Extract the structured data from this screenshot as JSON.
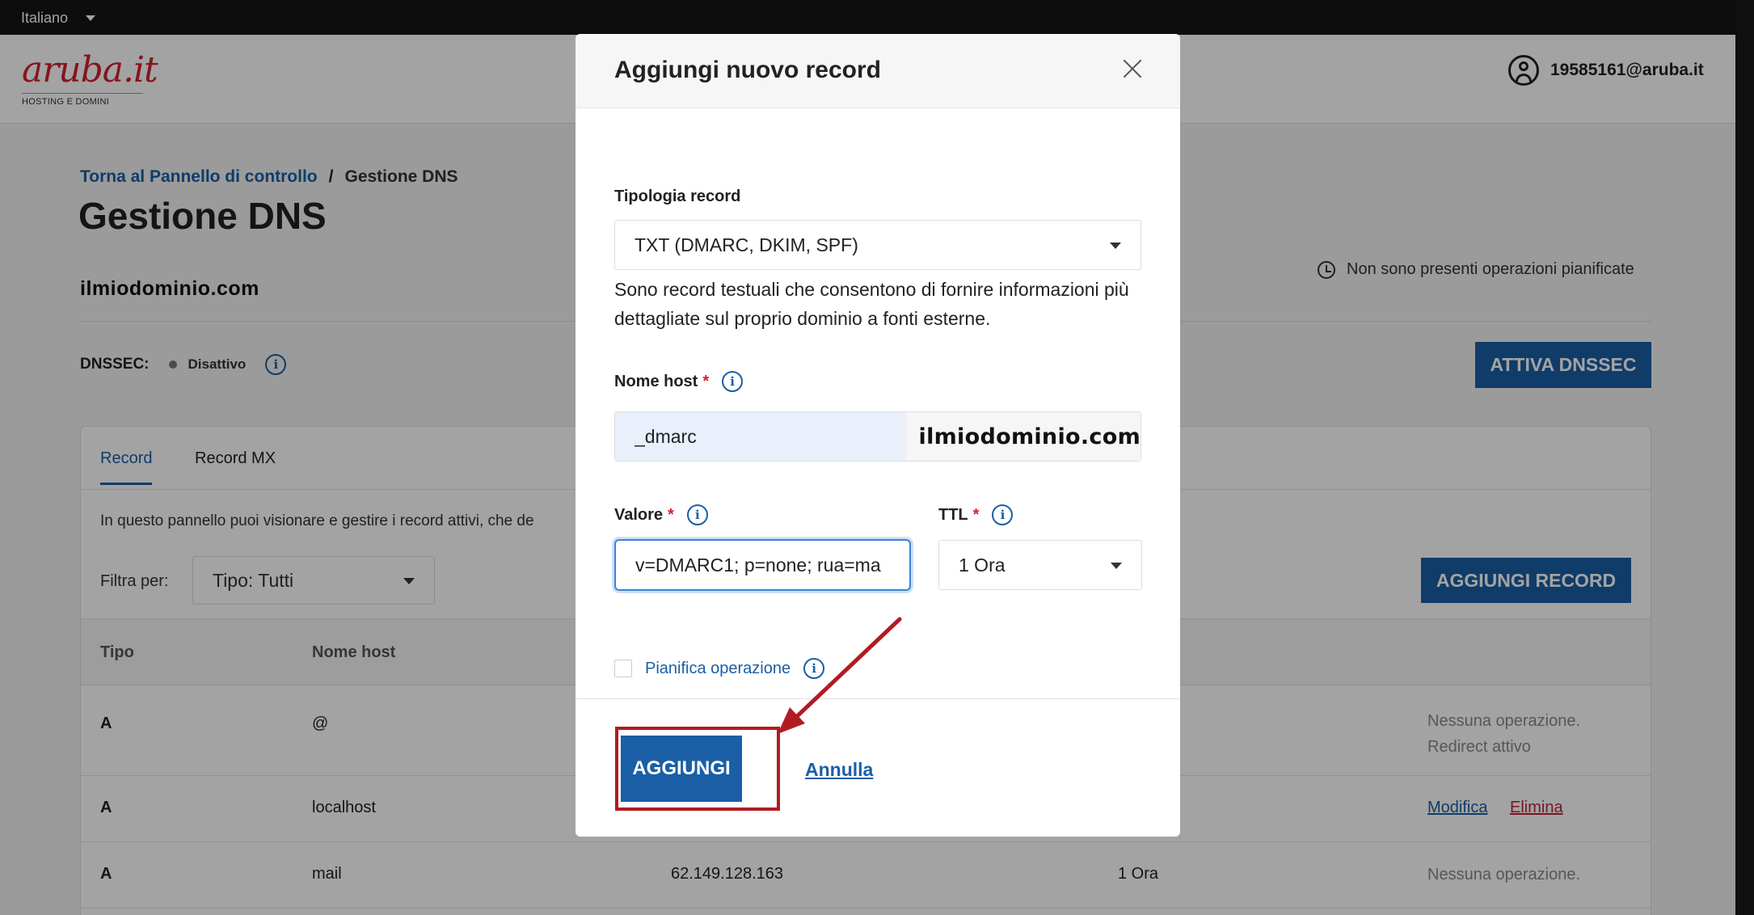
{
  "topbar": {
    "language": "Italiano"
  },
  "header": {
    "logo_text": "aruba.it",
    "logo_sub": "HOSTING E DOMINI",
    "user_email": "19585161@aruba.it"
  },
  "breadcrumb": {
    "back_link": "Torna al Pannello di controllo",
    "separator": "/",
    "current": "Gestione DNS"
  },
  "page": {
    "title": "Gestione DNS",
    "domain": "ilmiodominio.com",
    "scheduled_status": "Non sono presenti operazioni pianificate",
    "dnssec_label": "DNSSEC:",
    "dnssec_state": "Disattivo",
    "activate_dnssec_button": "ATTIVA DNSSEC"
  },
  "panel": {
    "tabs": [
      {
        "label": "Record",
        "active": true
      },
      {
        "label": "Record MX",
        "active": false
      }
    ],
    "description": "In questo pannello puoi visionare e gestire i record attivi, che de",
    "filter_label": "Filtra per:",
    "filter_value": "Tipo: Tutti",
    "add_record_button": "AGGIUNGI RECORD",
    "columns": [
      "Tipo",
      "Nome host"
    ],
    "rows": [
      {
        "type": "A",
        "host": "@",
        "value": "",
        "ttl": "",
        "status_line1": "Nessuna operazione.",
        "status_line2": "Redirect attivo"
      },
      {
        "type": "A",
        "host": "localhost",
        "value": "",
        "ttl": "",
        "action_edit": "Modifica",
        "action_delete": "Elimina"
      },
      {
        "type": "A",
        "host": "mail",
        "value": "62.149.128.163",
        "ttl": "1 Ora",
        "status_line1": "Nessuna operazione."
      }
    ]
  },
  "modal": {
    "title": "Aggiungi nuovo record",
    "record_type_label": "Tipologia record",
    "record_type_value": "TXT (DMARC, DKIM, SPF)",
    "description": "Sono record testuali che consentono di fornire informazioni più dettagliate sul proprio dominio a fonti esterne.",
    "host_label": "Nome host",
    "required_mark": "*",
    "host_value": "_dmarc",
    "host_suffix": "ilmiodominio.com",
    "value_label": "Valore",
    "value_value": "v=DMARC1; p=none; rua=ma",
    "ttl_label": "TTL",
    "ttl_value": "1 Ora",
    "schedule_label": "Pianifica operazione",
    "add_button": "AGGIUNGI",
    "cancel_link": "Annulla",
    "info_glyph": "i"
  },
  "colors": {
    "brand_red": "#d2202f",
    "primary_blue": "#1a5fa6",
    "annotation_red": "#b01c22"
  }
}
